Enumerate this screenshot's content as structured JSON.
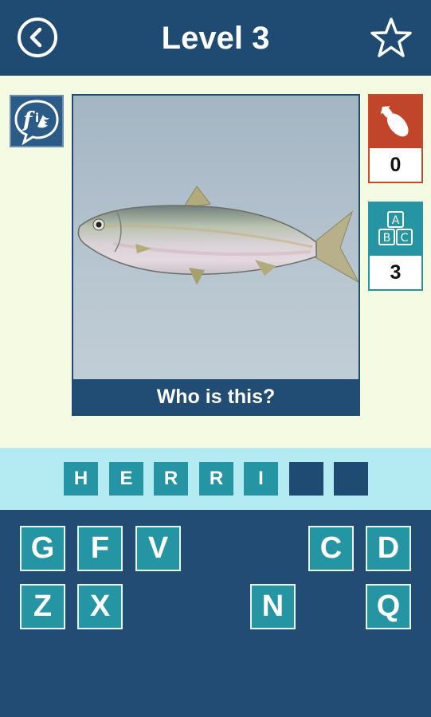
{
  "header": {
    "title": "Level 3",
    "back_icon": "back-arrow-circle-icon",
    "favorite_icon": "star-outline-icon"
  },
  "share": {
    "icon": "facebook-twitter-share-icon"
  },
  "puzzle": {
    "question": "Who is this?",
    "image_subject": "herring-fish"
  },
  "hints": {
    "bomb": {
      "icon": "bomb-icon",
      "count": "0",
      "color": "#c0452a"
    },
    "reveal_letter": {
      "icon": "abc-blocks-icon",
      "count": "3",
      "color": "#2595a3"
    }
  },
  "answer": {
    "letters": [
      "H",
      "E",
      "R",
      "R",
      "I",
      "",
      ""
    ]
  },
  "keyboard": {
    "row1": [
      "G",
      "F",
      "V",
      "",
      "",
      "C",
      "D"
    ],
    "row2": [
      "Z",
      "X",
      "",
      "",
      "N",
      "",
      "Q"
    ]
  },
  "colors": {
    "header_bg": "#1f4a72",
    "tile": "#2595a3",
    "play_bg": "#f4fbe2",
    "answer_bar": "#b4eaf1"
  }
}
